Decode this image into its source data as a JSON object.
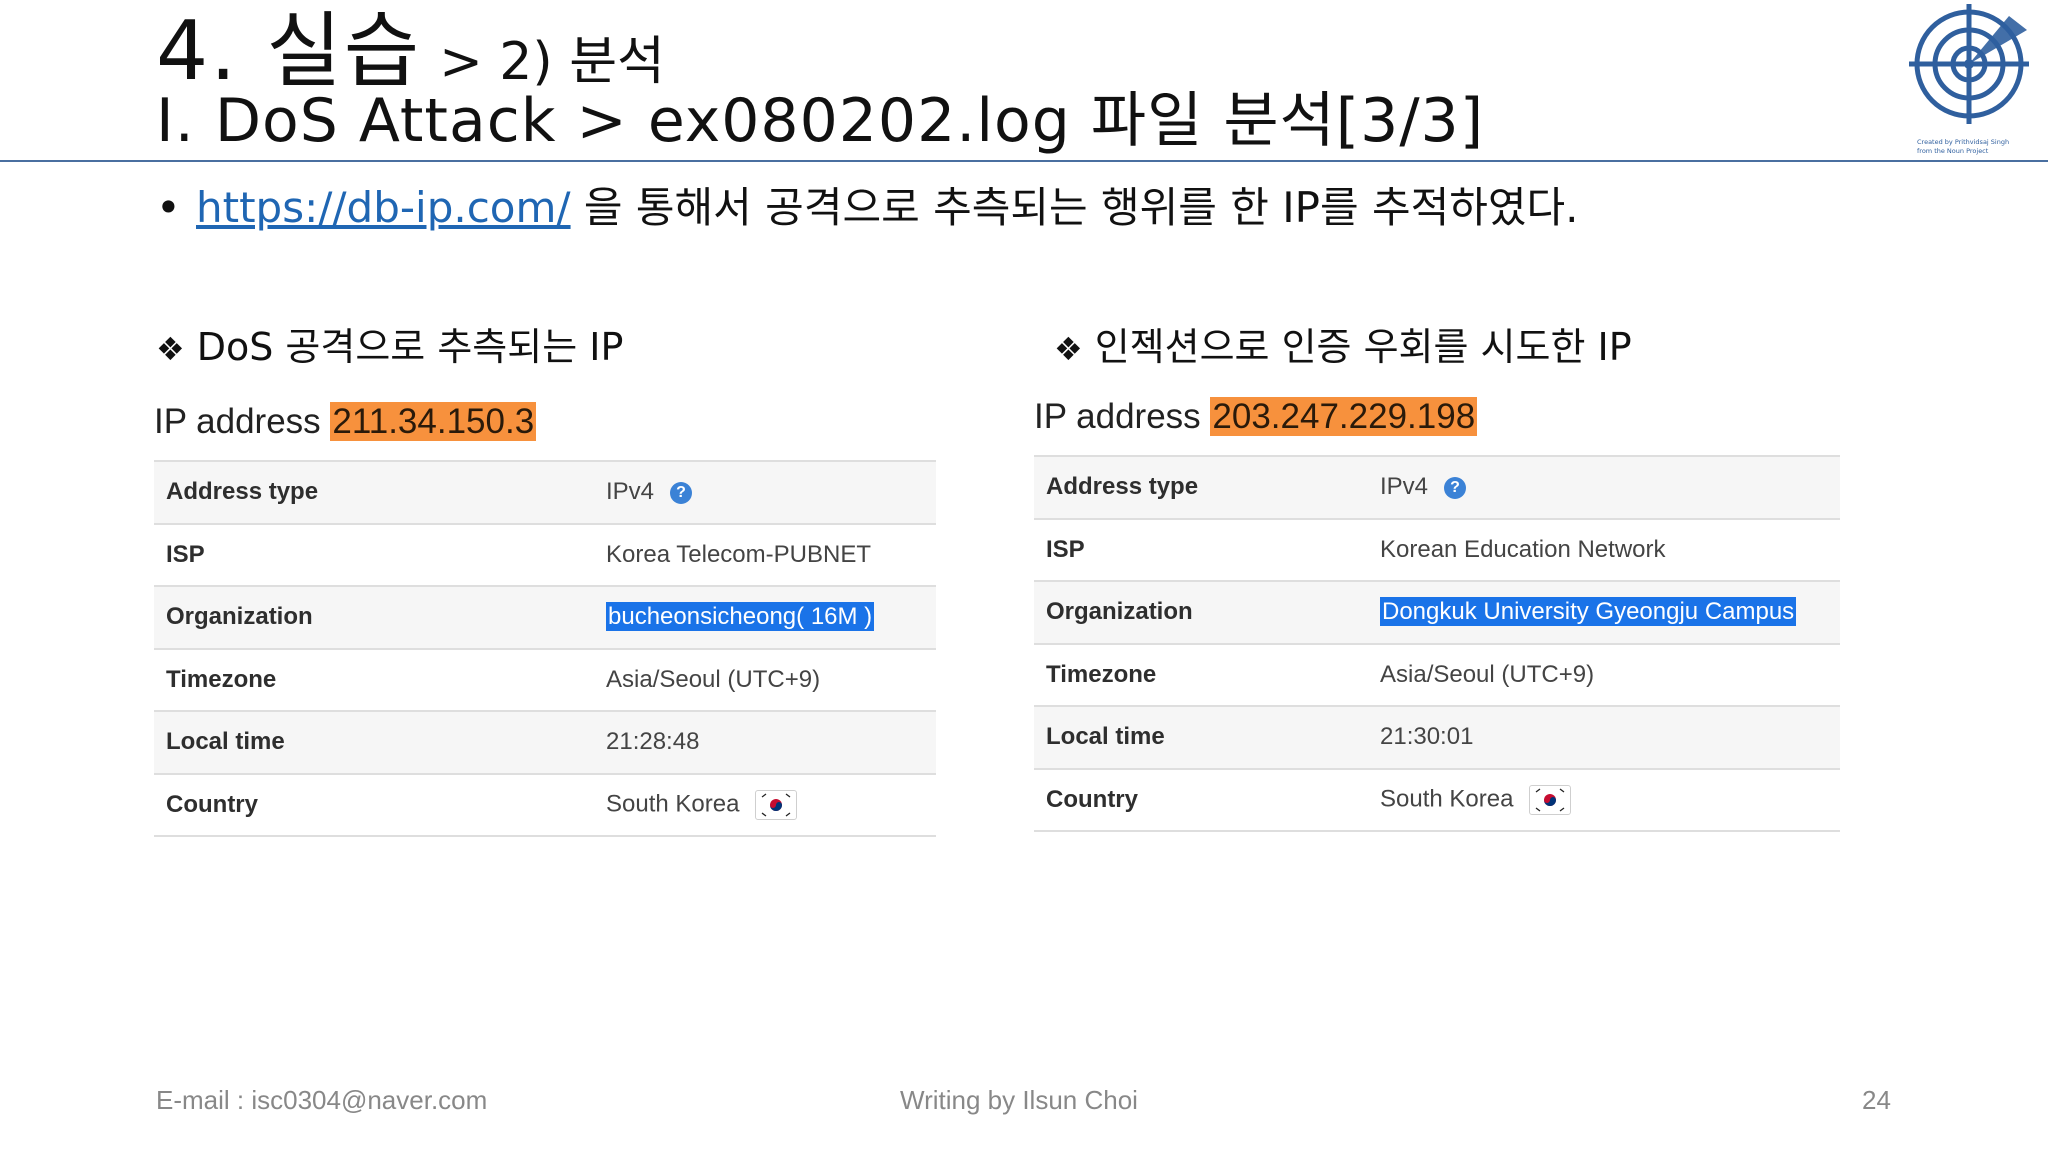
{
  "header": {
    "title_main": "4. 실습",
    "title_sub": "> 2) 분석",
    "subtitle": "I. DoS Attack > ex080202.log 파일 분석[3/3]"
  },
  "intro": {
    "bullet": "•",
    "link_text": "https://db-ip.com/",
    "text": " 을 통해서 공격으로 추측되는 행위를 한 IP를 추적하였다."
  },
  "left": {
    "heading_mark": "❖",
    "heading": "DoS 공격으로 추측되는 IP",
    "ip_label": "IP address ",
    "ip": "211.34.150.3",
    "rows": [
      {
        "key": "Address type",
        "value": "IPv4"
      },
      {
        "key": "ISP",
        "value": "Korea Telecom-PUBNET"
      },
      {
        "key": "Organization",
        "value": "bucheonsicheong( 16M )"
      },
      {
        "key": "Timezone",
        "value": "Asia/Seoul (UTC+9)"
      },
      {
        "key": "Local time",
        "value": "21:28:48"
      },
      {
        "key": "Country",
        "value": "South Korea"
      }
    ]
  },
  "right": {
    "heading_mark": "❖",
    "heading": "인젝션으로 인증 우회를 시도한 IP",
    "ip_label": "IP address ",
    "ip": "203.247.229.198",
    "rows": [
      {
        "key": "Address type",
        "value": "IPv4"
      },
      {
        "key": "ISP",
        "value": "Korean Education Network"
      },
      {
        "key": "Organization",
        "value": "Dongkuk University Gyeongju Campus"
      },
      {
        "key": "Timezone",
        "value": "Asia/Seoul (UTC+9)"
      },
      {
        "key": "Local time",
        "value": "21:30:01"
      },
      {
        "key": "Country",
        "value": "South Korea"
      }
    ]
  },
  "icons": {
    "help": "?",
    "flag": "south-korea-flag-icon",
    "logo": "radar-target-logo"
  },
  "logo_caption": {
    "line1": "Created by Prithvidsaj Singh",
    "line2": "from the Noun Project"
  },
  "footer": {
    "email": "E-mail : isc0304@naver.com",
    "author": "Writing by Ilsun Choi",
    "page": "24"
  },
  "colors": {
    "ip_highlight": "#f7913d",
    "selection": "#1a73e8",
    "link": "#1f66b3",
    "rule": "#4a6fa0"
  }
}
